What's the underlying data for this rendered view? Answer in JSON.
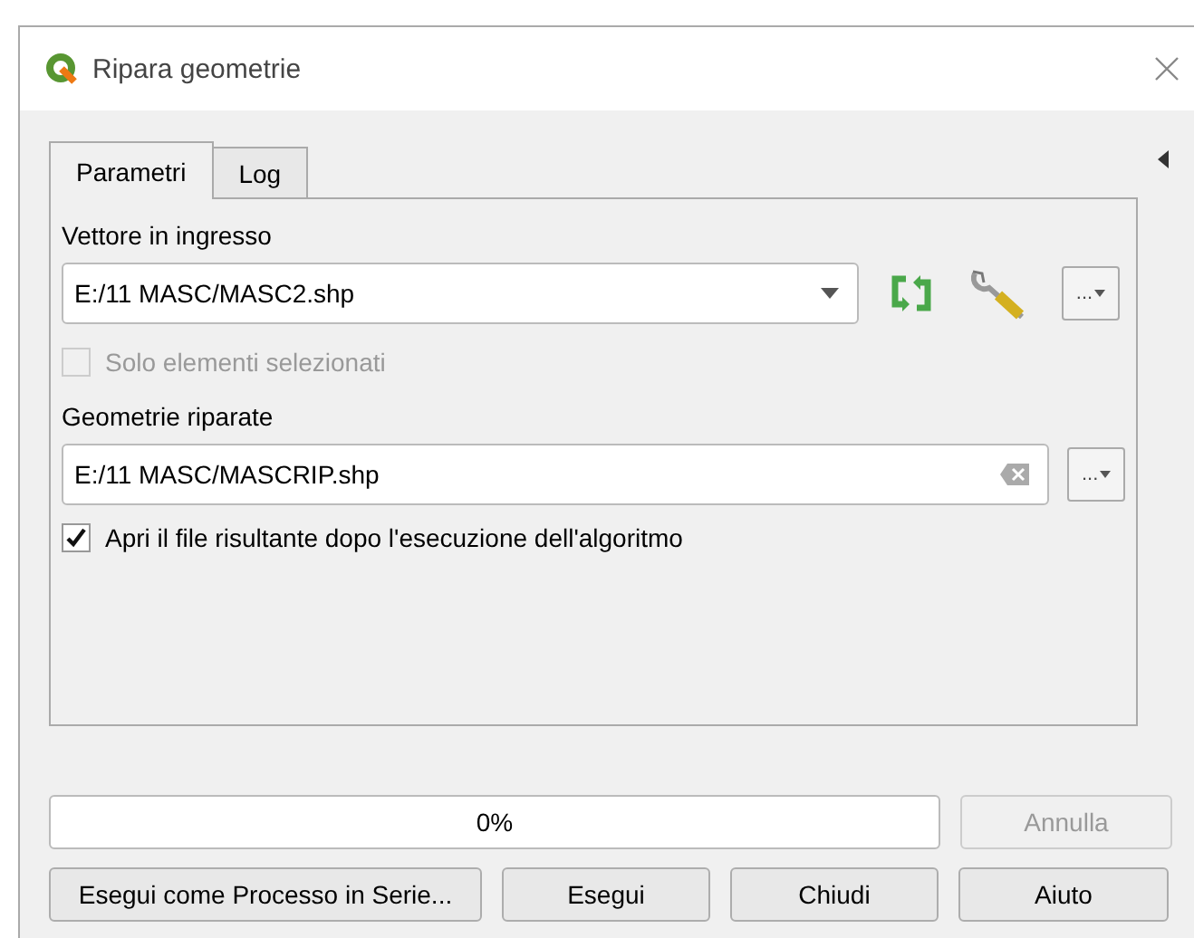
{
  "window": {
    "title": "Ripara geometrie"
  },
  "tabs": [
    {
      "label": "Parametri",
      "selected": true
    },
    {
      "label": "Log",
      "selected": false
    }
  ],
  "input_layer": {
    "label": "Vettore in ingresso",
    "value": "E:/11 MASC/MASC2.shp",
    "browse": "..."
  },
  "selected_only": {
    "label": "Solo elementi selezionati",
    "checked": false,
    "disabled": true
  },
  "output": {
    "label": "Geometrie riparate",
    "value": "E:/11 MASC/MASCRIP.shp",
    "browse": "..."
  },
  "open_after": {
    "label": "Apri il file risultante dopo l'esecuzione dell'algoritmo",
    "checked": true,
    "disabled": false
  },
  "progress": {
    "text": "0%",
    "level": 0
  },
  "cancel": {
    "label": "Annulla",
    "disabled": true
  },
  "buttons": [
    "Esegui come Processo in Serie...",
    "Esegui",
    "Chiudi",
    "Aiuto"
  ]
}
